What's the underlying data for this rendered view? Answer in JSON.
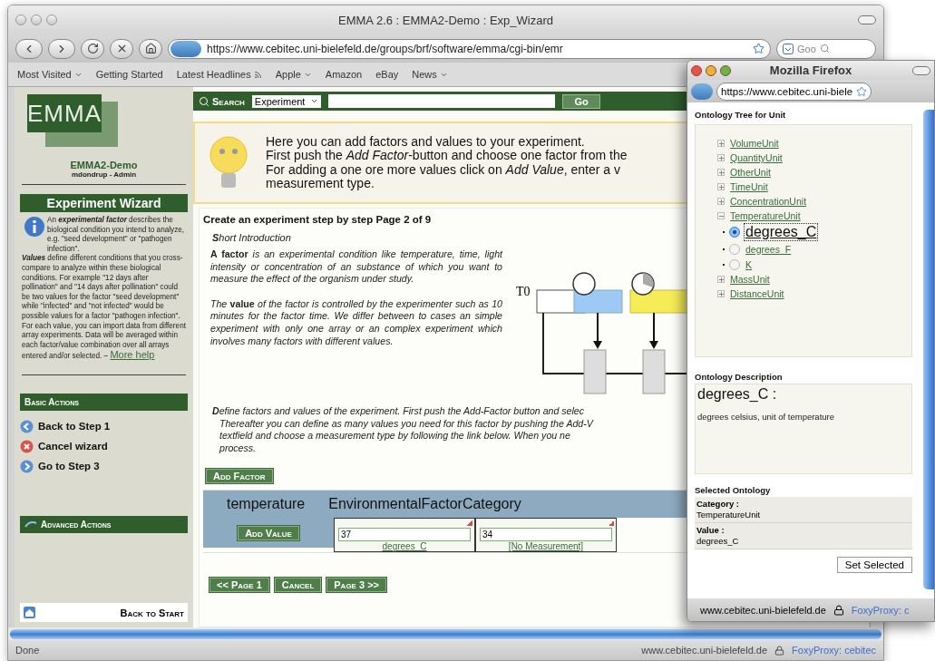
{
  "main_window": {
    "title": "EMMA 2.6 : EMMA2-Demo : Exp_Wizard",
    "url": "https://www.cebitec.uni-bielefeld.de/groups/brf/software/emma/cgi-bin/emr",
    "search_engine_field": "Goo"
  },
  "bookmarks": [
    {
      "label": "Most Visited",
      "kind": "menu"
    },
    {
      "label": "Getting Started",
      "kind": "link"
    },
    {
      "label": "Latest Headlines",
      "kind": "feed"
    },
    {
      "label": "Apple",
      "kind": "menu"
    },
    {
      "label": "Amazon",
      "kind": "link"
    },
    {
      "label": "eBay",
      "kind": "link"
    },
    {
      "label": "News",
      "kind": "menu"
    }
  ],
  "sidebar": {
    "logo": "EMMA",
    "project": "EMMA2-Demo",
    "user": "mdondrup - Admin",
    "wizard_title": "Experiment Wizard",
    "info_paragraphs": [
      "An **experimental factor** describes the biological condition you intend to analyze, e.g. \"seed development\" or \"pathogen infection\".",
      "**Values** define different conditions that you cross-compare to analyze within these biological conditions. For example \"12 days after pollination\" and \"14 days after pollination\" could be two values for the factor \"seed development\" while \"infected\" and \"not infected\" would be possible values for a factor \"pathogen infection\". For each value, you can import data from different array experiments. Data will be averaged within each factor/value combination over all arrays entered and/or selected. –"
    ],
    "more_help": "More help",
    "basic_actions_title": "Basic Actions",
    "basic_actions": [
      {
        "label": "Back to Step 1",
        "kind": "back"
      },
      {
        "label": "Cancel wizard",
        "kind": "cancel"
      },
      {
        "label": "Go to Step 3",
        "kind": "forward"
      }
    ],
    "advanced_actions_title": "Advanced Actions",
    "back_to_start": "Back to Start"
  },
  "search_bar": {
    "label": "Search",
    "scope": "Experiment",
    "button": "Go"
  },
  "hint_lines": [
    "Here you can add factors and values to your experiment.",
    "First push the *Add Factor*-button and choose one factor from the",
    "For adding a one ore more values click on *Add Value*, enter a v",
    "measurement type."
  ],
  "wizard": {
    "heading": "Create an experiment step by step Page 2 of 9",
    "section": "**S**hort Introduction",
    "paragraphs": [
      "**A factor** is an experimental condition like temperature, time, light intensity or concentration of an substance of which you want to measure the effect of the organism under study.",
      "The **value** of the factor is controlled by the experimenter such as 10 minutes for the factor time. We differ between to cases an simple experiment with only one array or an complex experiment which involves many factors with different values."
    ],
    "diagram_label": "T0",
    "define_lines": [
      "**D**efine factors and values of the experiment. First push the Add-Factor button and selec",
      "Thereafter you can define as many values you need for this factor by pushing the Add-V",
      "textfield and choose a measurement type by following the link below. When you ne",
      "process."
    ],
    "add_factor": "Add Factor",
    "factors": [
      {
        "name": "temperature",
        "category": "EnvironmentalFactorCategory",
        "add_value": "Add Value",
        "values": [
          {
            "value": "37",
            "unit": "degrees_C"
          },
          {
            "value": "34",
            "unit": "[No Measurement]"
          }
        ]
      }
    ],
    "nav_buttons": [
      "<< Page 1",
      "Cancel",
      "Page 3 >>"
    ]
  },
  "status_bar": {
    "text": "Done",
    "host": "www.cebitec.uni-bielefeld.de",
    "proxy": "FoxyProxy: cebitec"
  },
  "popup": {
    "title": "Mozilla Firefox",
    "url": "https://www.cebitec.uni-biele",
    "tree_title": "Ontology Tree for Unit",
    "tree": [
      {
        "label": "VolumeUnit",
        "expanded": false
      },
      {
        "label": "QuantityUnit",
        "expanded": false
      },
      {
        "label": "OtherUnit",
        "expanded": false
      },
      {
        "label": "TimeUnit",
        "expanded": false
      },
      {
        "label": "ConcentrationUnit",
        "expanded": false
      },
      {
        "label": "TemperatureUnit",
        "expanded": true,
        "children": [
          {
            "label": "degrees_C",
            "selected": true
          },
          {
            "label": "degrees_F",
            "selected": false
          },
          {
            "label": "K",
            "selected": false
          }
        ]
      },
      {
        "label": "MassUnit",
        "expanded": false
      },
      {
        "label": "DistanceUnit",
        "expanded": false
      }
    ],
    "description_title": "Ontology Description",
    "description_term": "degrees_C :",
    "description_text": "degrees celsius, unit of temperature",
    "selected_title": "Selected Ontology",
    "selected_fields": [
      {
        "label": "Category :",
        "value": "TemperatureUnit"
      },
      {
        "label": "Value :",
        "value": "degrees_C"
      }
    ],
    "button": "Set Selected",
    "status_host": "www.cebitec.uni-bielefeld.de",
    "status_proxy": "FoxyProxy: c"
  }
}
